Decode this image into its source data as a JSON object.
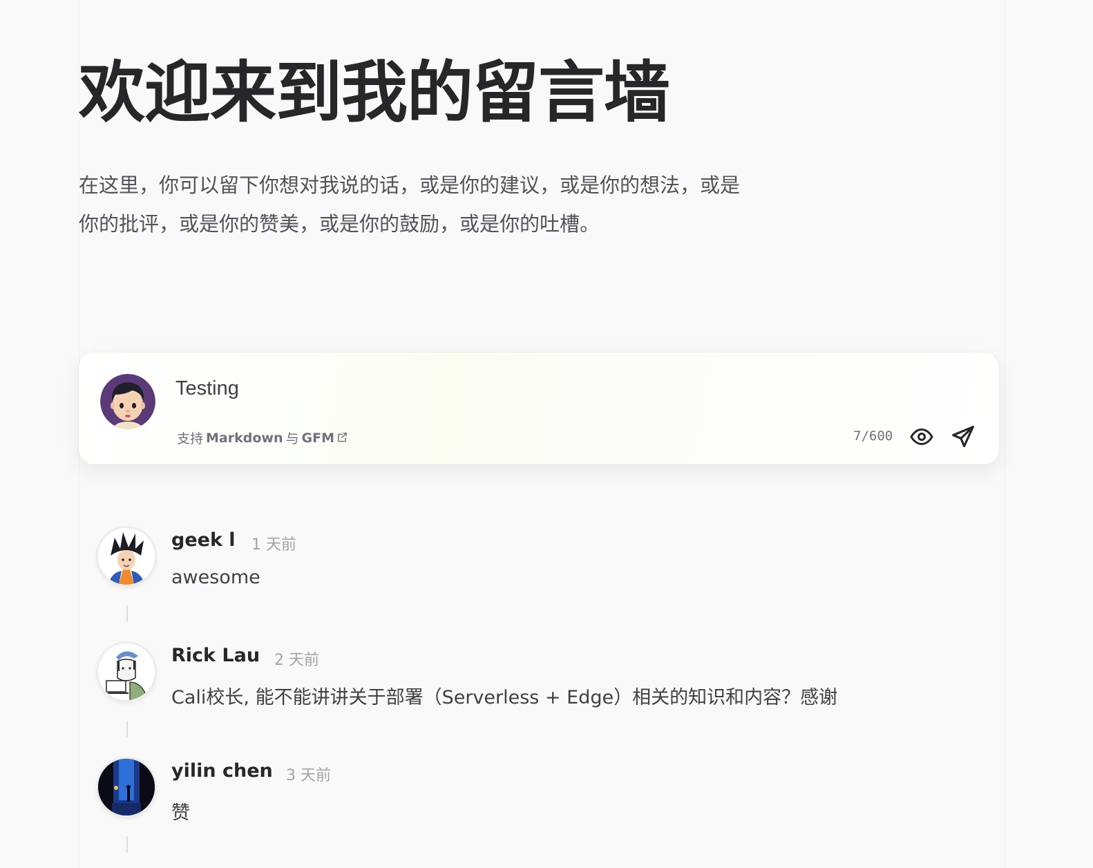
{
  "page": {
    "title": "欢迎来到我的留言墙",
    "intro": "在这里，你可以留下你想对我说的话，或是你的建议，或是你的想法，或是你的批评，或是你的赞美，或是你的鼓励，或是你的吐槽。"
  },
  "composer": {
    "input_value": "Testing",
    "hint_prefix": "支持",
    "hint_markdown": "Markdown",
    "hint_and": "与",
    "hint_gfm": "GFM",
    "char_count": "7/600",
    "preview_icon": "eye-icon",
    "send_icon": "send-icon",
    "link_icon": "external-link-icon"
  },
  "comments": [
    {
      "name": "geek l",
      "time": "1 天前",
      "body": "awesome",
      "avatar_icon": "goku-avatar"
    },
    {
      "name": "Rick Lau",
      "time": "2 天前",
      "body": "Cali校长, 能不能讲讲关于部署（Serverless + Edge）相关的知识和内容？感谢",
      "avatar_icon": "sketch-avatar"
    },
    {
      "name": "yilin chen",
      "time": "3 天前",
      "body": "赞",
      "avatar_icon": "night-street-avatar"
    }
  ]
}
